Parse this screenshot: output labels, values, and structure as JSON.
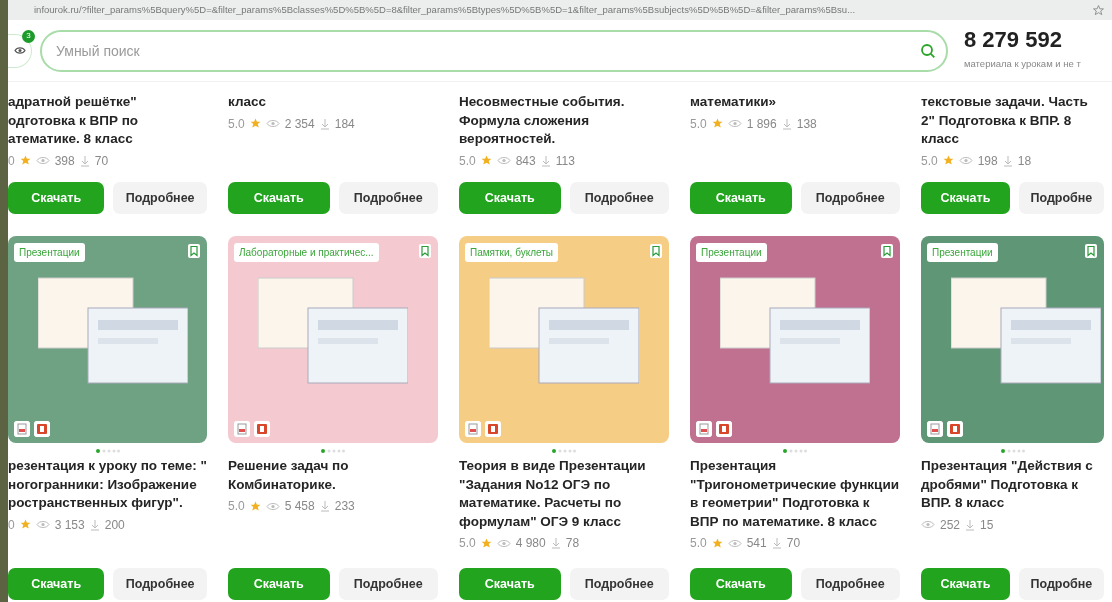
{
  "address_bar": {
    "url": "infourok.ru/?filter_params%5Bquery%5D=&filter_params%5Bclasses%5D%5B%5D=8&filter_params%5Btypes%5D%5B%5D=1&filter_params%5Bsubjects%5D%5B%5D=&filter_params%5Bsu..."
  },
  "header": {
    "notification_count": "3",
    "search": {
      "placeholder": "Умный поиск"
    },
    "total": "8 279 592",
    "total_caption": "материала к урокам и не т"
  },
  "top_row": [
    {
      "title": "адратной решётке\" одготовка к ВПР по атематике. 8 класс",
      "rating": "0",
      "views": "398",
      "downloads": "70",
      "buttons": [
        "Скачать",
        "Подробнее"
      ]
    },
    {
      "title": "класс",
      "rating": "5.0",
      "views": "2 354",
      "downloads": "184",
      "buttons": [
        "Скачать",
        "Подробнее"
      ]
    },
    {
      "title": "Несовместные события. Формула сложения вероятностей.",
      "rating": "5.0",
      "views": "843",
      "downloads": "113",
      "buttons": [
        "Скачать",
        "Подробнее"
      ]
    },
    {
      "title": "математики»",
      "rating": "5.0",
      "views": "1 896",
      "downloads": "138",
      "buttons": [
        "Скачать",
        "Подробнее"
      ]
    },
    {
      "title": "текстовые задачи. Часть 2\" Подготовка к ВПР. 8 класс",
      "rating": "5.0",
      "views": "198",
      "downloads": "18",
      "buttons": [
        "Скачать",
        "Подробне"
      ]
    }
  ],
  "bottom_row": [
    {
      "tag": "Презентации",
      "color": "#6fa283",
      "title": "резентация к уроку по теме: \" ногогранники: Изображение ространственных фигур\".",
      "rating": "0",
      "views": "3 153",
      "downloads": "200",
      "buttons": [
        "Скачать",
        "Подробнее"
      ]
    },
    {
      "tag": "Лабораторные и практичес...",
      "color": "#f4c9cf",
      "title": "Решение задач по Комбинаторике.",
      "rating": "5.0",
      "views": "5 458",
      "downloads": "233",
      "buttons": [
        "Скачать",
        "Подробнее"
      ]
    },
    {
      "tag": "Памятки, буклеты",
      "color": "#f6cd85",
      "title": "Теория в виде Презентации \"Задания No12 ОГЭ по математике. Расчеты по формулам\" ОГЭ 9 класс",
      "rating": "5.0",
      "views": "4 980",
      "downloads": "78",
      "buttons": [
        "Скачать",
        "Подробнее"
      ]
    },
    {
      "tag": "Презентации",
      "color": "#c0718f",
      "title": "Презентация \"Тригонометрические функции в геометрии\" Подготовка к ВПР по математике. 8 класс",
      "rating": "5.0",
      "views": "541",
      "downloads": "70",
      "buttons": [
        "Скачать",
        "Подробнее"
      ]
    },
    {
      "tag": "Презентации",
      "color": "#5f9776",
      "title": "Презентация \"Действия с дробями\" Подготовка к ВПР. 8 класс",
      "views": "252",
      "downloads": "15",
      "buttons": [
        "Скачать",
        "Подробне"
      ]
    }
  ]
}
